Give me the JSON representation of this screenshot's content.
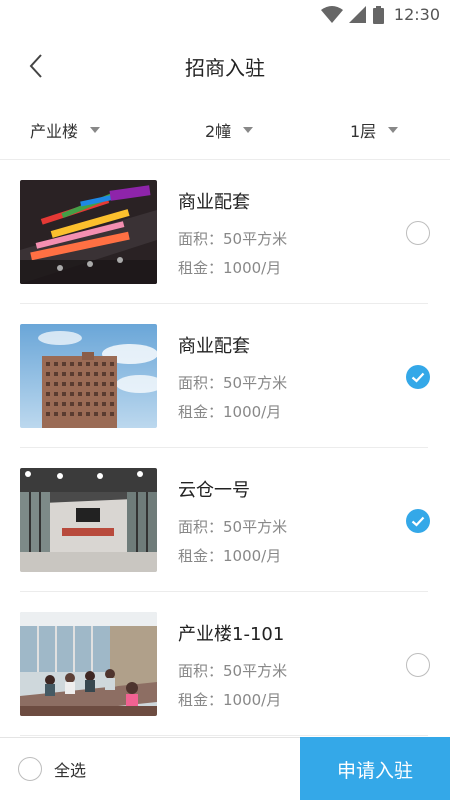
{
  "status_bar": {
    "time": "12:30"
  },
  "header": {
    "title": "招商入驻"
  },
  "filters": [
    {
      "label": "产业楼"
    },
    {
      "label": "2幢"
    },
    {
      "label": "1层"
    }
  ],
  "items": [
    {
      "title": "商业配套",
      "area": "面积：50平方米",
      "rent": "租金：1000/月",
      "checked": false,
      "image": "stationery-photo"
    },
    {
      "title": "商业配套",
      "area": "面积：50平方米",
      "rent": "租金：1000/月",
      "checked": true,
      "image": "building-photo"
    },
    {
      "title": "云仓一号",
      "area": "面积：50平方米",
      "rent": "租金：1000/月",
      "checked": true,
      "image": "office-interior-photo"
    },
    {
      "title": "产业楼1-101",
      "area": "面积：50平方米",
      "rent": "租金：1000/月",
      "checked": false,
      "image": "meeting-room-photo"
    }
  ],
  "footer": {
    "select_all_label": "全选",
    "apply_label": "申请入驻"
  },
  "colors": {
    "accent": "#34a8e8",
    "divider": "#ececec",
    "muted_text": "#888888"
  }
}
